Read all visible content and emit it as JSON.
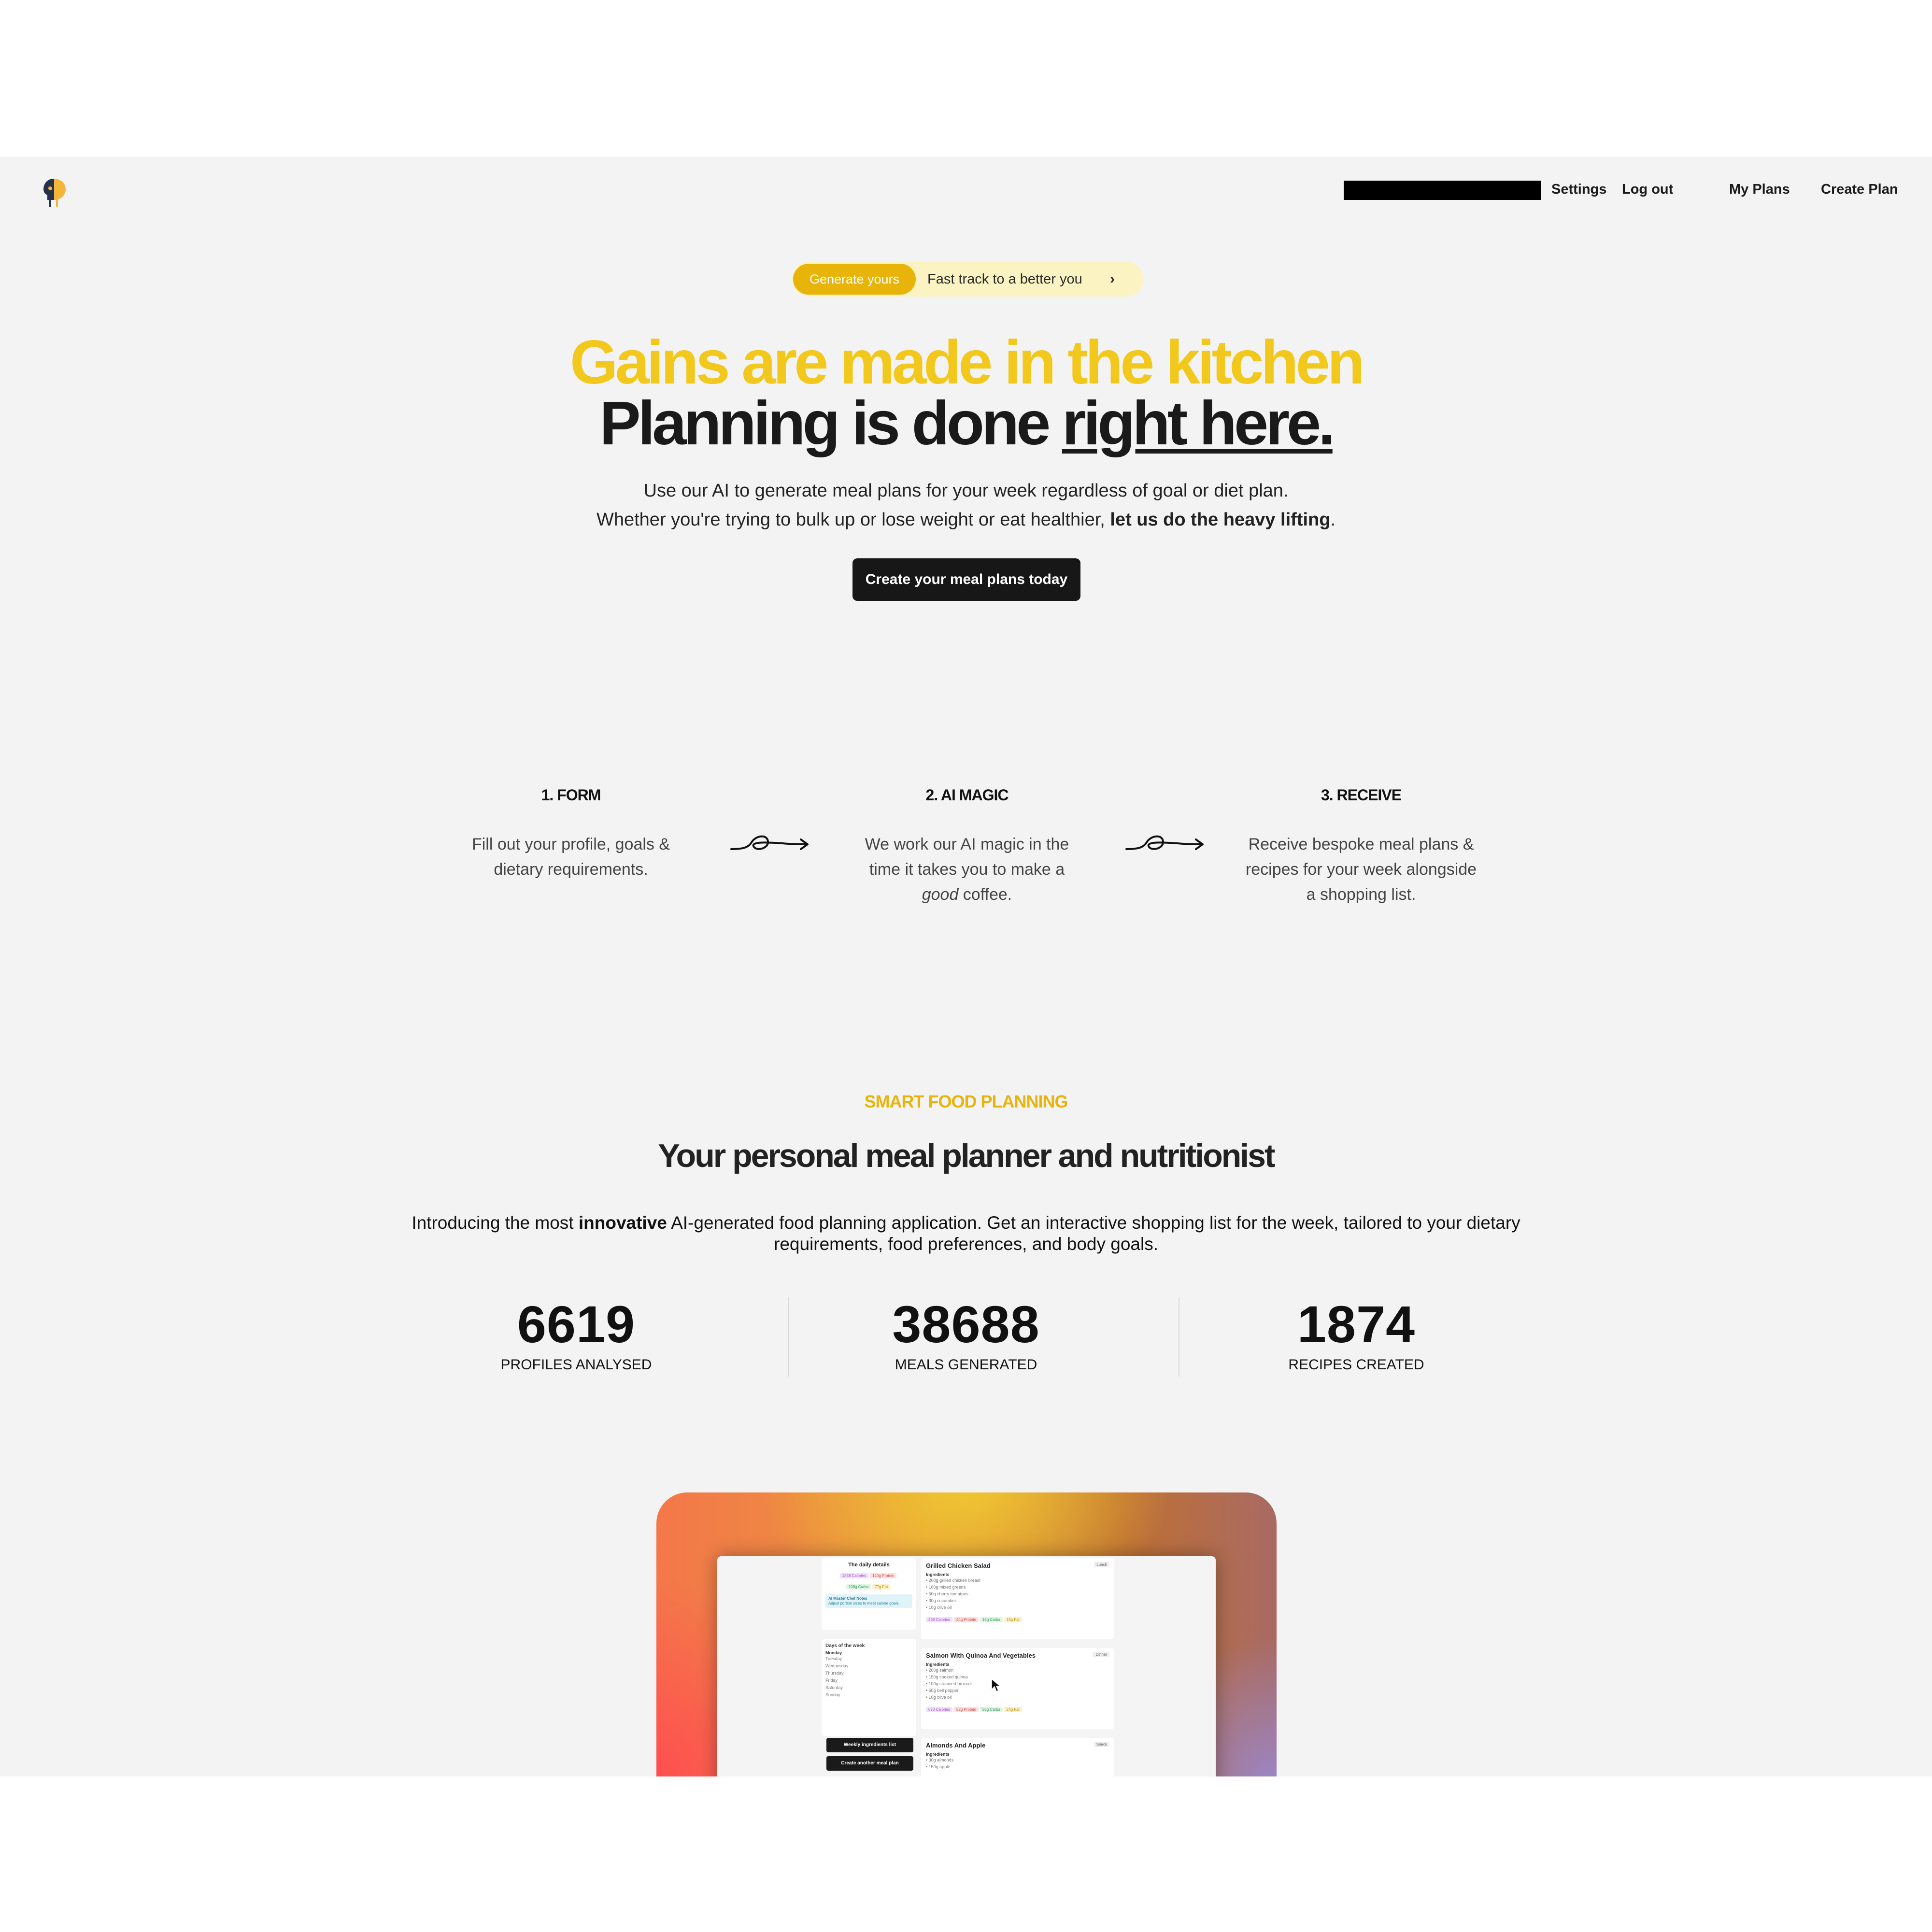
{
  "nav": {
    "settings": "Settings",
    "logout": "Log out",
    "my_plans": "My Plans",
    "create_plan": "Create Plan"
  },
  "hero": {
    "badge": "Generate yours",
    "pill_text": "Fast track to a better you",
    "headline_1": "Gains are made in the kitchen",
    "headline_2_prefix": "Planning is done ",
    "headline_2_underlined": "right here.",
    "sub_1": "Use our AI to generate meal plans for your week regardless of goal or diet plan.",
    "sub_2_prefix": "Whether you're trying to bulk up or lose weight or eat healthier, ",
    "sub_2_bold": "let us do the heavy lifting",
    "sub_2_suffix": ".",
    "cta": "Create your meal plans today"
  },
  "steps": [
    {
      "title": "1. FORM",
      "text": "Fill out your profile, goals & dietary requirements."
    },
    {
      "title": "2. AI MAGIC",
      "text_prefix": "We work our AI magic in the time it takes you to make a ",
      "text_italic": "good",
      "text_suffix": " coffee."
    },
    {
      "title": "3. RECEIVE",
      "text": "Receive bespoke meal plans & recipes for your week alongside a shopping list."
    }
  ],
  "smart": {
    "eyebrow": "SMART FOOD PLANNING",
    "title": "Your personal meal planner and nutritionist",
    "intro_prefix": "Introducing the most ",
    "intro_bold": "innovative",
    "intro_suffix": " AI-generated food planning application. Get an interactive shopping list for the week, tailored to your dietary requirements, food preferences, and body goals."
  },
  "stats": [
    {
      "value": "6619",
      "label": "PROFILES ANALYSED"
    },
    {
      "value": "38688",
      "label": "MEALS GENERATED"
    },
    {
      "value": "1874",
      "label": "RECIPES CREATED"
    }
  ],
  "preview": {
    "daily_title": "The daily details",
    "daily_tags": [
      "1858 Calories",
      "140g Protein",
      "108g Carbs",
      "77g Fat"
    ],
    "chef_note_title": "AI Master Chef Notes",
    "chef_note_text": "Adjust portion sizes to meet calorie goals.",
    "days_title": "Days of the week",
    "days": [
      "Monday",
      "Tuesday",
      "Wednesday",
      "Thursday",
      "Friday",
      "Saturday",
      "Sunday"
    ],
    "btn_ingredients": "Weekly ingredients list",
    "btn_another": "Create another meal plan",
    "ingredients_label": "Ingredients",
    "meals": [
      {
        "name": "Grilled Chicken Salad",
        "type": "Lunch",
        "items": [
          "200g grilled chicken breast",
          "100g mixed greens",
          "50g cherry tomatoes",
          "30g cucumber",
          "10g olive oil"
        ],
        "tags": [
          "469 Calories",
          "44g Protein",
          "16g Carbs",
          "15g Fat"
        ]
      },
      {
        "name": "Salmon With Quinoa And Vegetables",
        "type": "Dinner",
        "items": [
          "200g salmon",
          "150g cooked quinoa",
          "100g steamed broccoli",
          "50g bell pepper",
          "10g olive oil"
        ],
        "tags": [
          "673 Calories",
          "52g Protein",
          "55g Carbs",
          "24g Fat"
        ]
      },
      {
        "name": "Almonds And Apple",
        "type": "Snack",
        "items": [
          "30g almonds",
          "150g apple"
        ],
        "tags": []
      }
    ]
  },
  "colors": {
    "accent_yellow": "#f2c81c",
    "badge_yellow": "#e9b40a",
    "pill_bg": "#fbf3c2",
    "dark": "#171717",
    "page_bg": "#f3f3f3"
  }
}
